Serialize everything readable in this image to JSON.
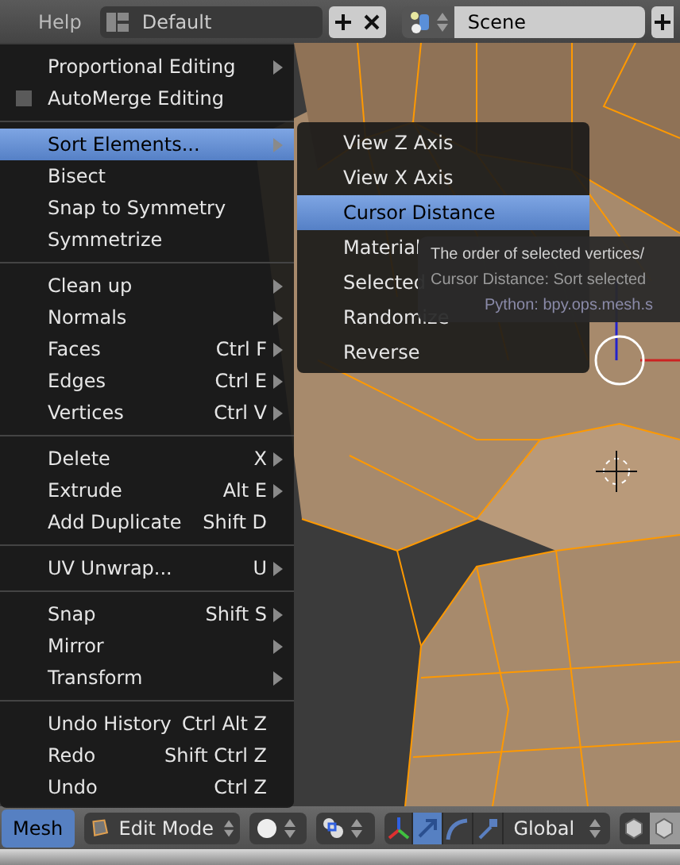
{
  "top_bar": {
    "menu_label": "Help",
    "layout": "Default",
    "scene": "Scene"
  },
  "mesh_menu": {
    "items": [
      {
        "kind": "item",
        "label": "Proportional Editing",
        "submenu": true,
        "selected": false
      },
      {
        "kind": "checkbox",
        "label": "AutoMerge Editing",
        "checked": false
      },
      {
        "kind": "separator"
      },
      {
        "kind": "item",
        "label": "Sort Elements...",
        "submenu": true,
        "selected": true
      },
      {
        "kind": "item",
        "label": "Bisect",
        "submenu": false,
        "selected": false
      },
      {
        "kind": "item",
        "label": "Snap to Symmetry",
        "submenu": false,
        "selected": false
      },
      {
        "kind": "item",
        "label": "Symmetrize",
        "submenu": false,
        "selected": false
      },
      {
        "kind": "separator"
      },
      {
        "kind": "item",
        "label": "Clean up",
        "submenu": true,
        "selected": false
      },
      {
        "kind": "item",
        "label": "Normals",
        "submenu": true,
        "selected": false
      },
      {
        "kind": "item",
        "label": "Faces",
        "shortcut": "Ctrl F",
        "submenu": true,
        "selected": false
      },
      {
        "kind": "item",
        "label": "Edges",
        "shortcut": "Ctrl E",
        "submenu": true,
        "selected": false
      },
      {
        "kind": "item",
        "label": "Vertices",
        "shortcut": "Ctrl V",
        "submenu": true,
        "selected": false
      },
      {
        "kind": "separator"
      },
      {
        "kind": "item",
        "label": "Delete",
        "shortcut": "X",
        "submenu": true,
        "selected": false
      },
      {
        "kind": "item",
        "label": "Extrude",
        "shortcut": "Alt E",
        "submenu": true,
        "selected": false
      },
      {
        "kind": "item",
        "label": "Add Duplicate",
        "shortcut": "Shift D",
        "submenu": false,
        "selected": false
      },
      {
        "kind": "separator"
      },
      {
        "kind": "item",
        "label": "UV Unwrap...",
        "shortcut": "U",
        "submenu": true,
        "selected": false
      },
      {
        "kind": "separator"
      },
      {
        "kind": "item",
        "label": "Snap",
        "shortcut": "Shift S",
        "submenu": true,
        "selected": false
      },
      {
        "kind": "item",
        "label": "Mirror",
        "submenu": true,
        "selected": false
      },
      {
        "kind": "item",
        "label": "Transform",
        "submenu": true,
        "selected": false
      },
      {
        "kind": "separator"
      },
      {
        "kind": "item",
        "label": "Undo History",
        "shortcut": "Ctrl Alt Z",
        "submenu": false,
        "selected": false
      },
      {
        "kind": "item",
        "label": "Redo",
        "shortcut": "Shift Ctrl Z",
        "submenu": false,
        "selected": false
      },
      {
        "kind": "item",
        "label": "Undo",
        "shortcut": "Ctrl Z",
        "submenu": false,
        "selected": false
      }
    ]
  },
  "sort_submenu": {
    "items": [
      {
        "label": "View Z Axis",
        "selected": false
      },
      {
        "label": "View X Axis",
        "selected": false
      },
      {
        "label": "Cursor Distance",
        "selected": true
      },
      {
        "label": "Material",
        "selected": false
      },
      {
        "label": "Selected",
        "selected": false
      },
      {
        "label": "Randomize",
        "selected": false
      },
      {
        "label": "Reverse",
        "selected": false
      }
    ]
  },
  "tooltip": {
    "description": "The order of selected vertices/",
    "detail": "Cursor Distance: Sort selected",
    "python": "Python: bpy.ops.mesh.s"
  },
  "header": {
    "menu": {
      "label": "Mesh",
      "selected": true
    },
    "mode": "Edit Mode",
    "orientation": "Global",
    "manipulators": [
      {
        "kind": "axes",
        "selected": false
      },
      {
        "kind": "translate",
        "selected": true
      },
      {
        "kind": "rotate",
        "selected": false
      },
      {
        "kind": "scale",
        "selected": false
      }
    ],
    "layers": [
      {
        "selected": false
      },
      {
        "selected": true
      }
    ]
  }
}
